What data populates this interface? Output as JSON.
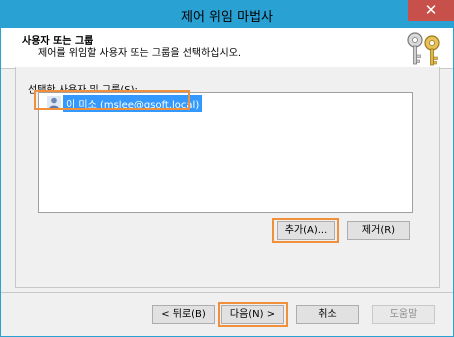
{
  "window": {
    "title": "제어 위임 마법사",
    "close_glyph": "✕"
  },
  "header": {
    "title": "사용자 또는 그룹",
    "description": "제어를 위임할 사용자 또는 그룹을 선택하십시오.",
    "icon": "keys-icon"
  },
  "list": {
    "label": "선택한 사용자 및 그룹(S):",
    "items": [
      {
        "label": "이 미소 (mslee@gsoft.local)",
        "icon": "user-icon",
        "selected": true
      }
    ]
  },
  "buttons": {
    "add": "추가(A)...",
    "remove": "제거(R)",
    "back": "< 뒤로(B)",
    "next": "다음(N) >",
    "cancel": "취소",
    "help": "도움말"
  },
  "colors": {
    "title_bar": "#29a1d3",
    "close_button": "#c7504b",
    "highlight": "#f08f3c",
    "selection": "#3399ff"
  }
}
